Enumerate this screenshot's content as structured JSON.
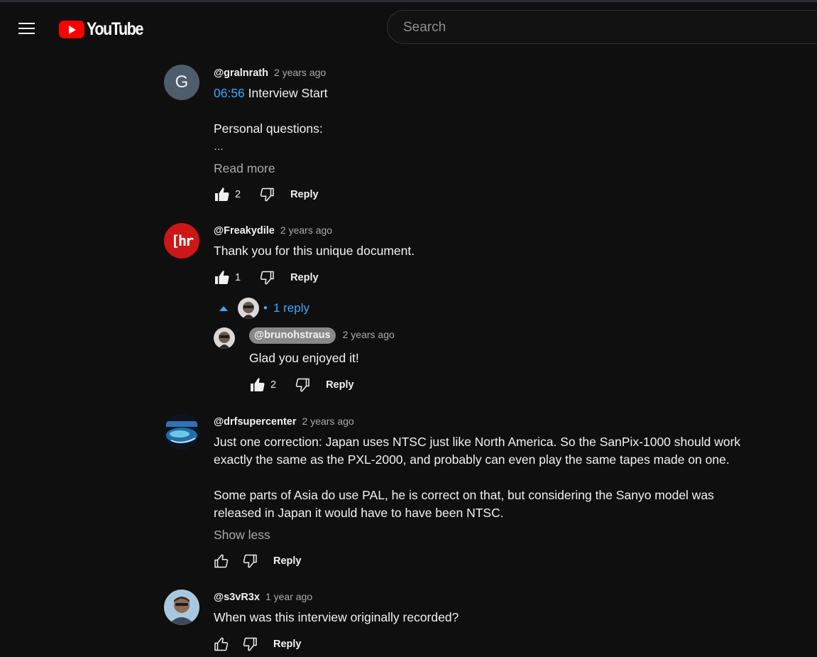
{
  "app": {
    "logo_text": "YouTube"
  },
  "search": {
    "placeholder": "Search"
  },
  "comments": [
    {
      "author": "@gralnrath",
      "time": "2 years ago",
      "avatar_letter": "G",
      "timestamp_link": "06:56",
      "line1_rest": " Interview Start",
      "line2": "Personal questions:",
      "line3": "…",
      "expand_label": "Read more",
      "likes": "2",
      "reply_label": "Reply"
    },
    {
      "author": "@Freakydile",
      "time": "2 years ago",
      "avatar_text": "[hr",
      "text": "Thank you for this unique document.",
      "likes": "1",
      "reply_label": "Reply",
      "replies_toggle": "1 reply",
      "replies": [
        {
          "author": "@brunohstraus",
          "time": "2 years ago",
          "text": "Glad you enjoyed it!",
          "likes": "2",
          "reply_label": "Reply"
        }
      ]
    },
    {
      "author": "@drfsupercenter",
      "time": "2 years ago",
      "text_p1_l1": "Just one correction: Japan uses NTSC just like North America.  So the SanPix-1000 should work",
      "text_p1_l2": "exactly the same as the PXL-2000, and probably can even play the same tapes made on one.",
      "text_p2_l1": "Some parts of Asia do use PAL, he is correct on that, but considering the Sanyo model was",
      "text_p2_l2": "released in Japan it would have to have been NTSC.",
      "collapse_label": "Show less",
      "reply_label": "Reply"
    },
    {
      "author": "@s3vR3x",
      "time": "1 year ago",
      "text": "When was this interview originally recorded?",
      "reply_label": "Reply"
    }
  ],
  "colors": {
    "background": "#0f0f0f",
    "link": "#3ea6ff",
    "brand_red": "#ff0000"
  }
}
